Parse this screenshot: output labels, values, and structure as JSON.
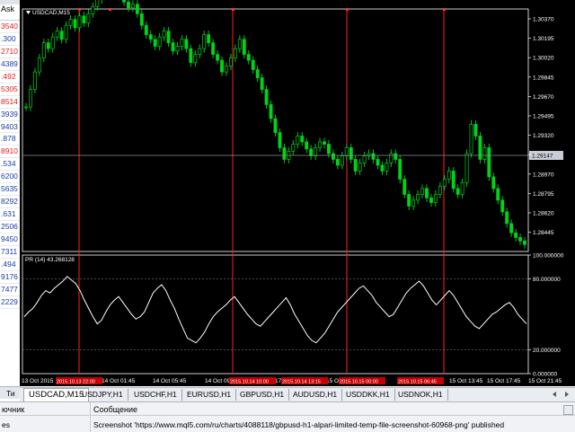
{
  "market_watch": {
    "header_label": "Ask",
    "rows": [
      {
        "value": "3540",
        "color": "red"
      },
      {
        "value": ".300",
        "color": "blue"
      },
      {
        "value": "2710",
        "color": "red"
      },
      {
        "value": "4389",
        "color": "blue"
      },
      {
        "value": ".492",
        "color": "red"
      },
      {
        "value": "5305",
        "color": "red"
      },
      {
        "value": "8514",
        "color": "red"
      },
      {
        "value": "3939",
        "color": "blue"
      },
      {
        "value": "9403",
        "color": "blue"
      },
      {
        "value": ".878",
        "color": "blue"
      },
      {
        "value": "8910",
        "color": "red"
      },
      {
        "value": ".534",
        "color": "blue"
      },
      {
        "value": "6200",
        "color": "blue"
      },
      {
        "value": "5635",
        "color": "blue"
      },
      {
        "value": "8292",
        "color": "blue"
      },
      {
        "value": ".631",
        "color": "blue"
      },
      {
        "value": "2506",
        "color": "blue"
      },
      {
        "value": "9450",
        "color": "blue"
      },
      {
        "value": "7311",
        "color": "blue"
      },
      {
        "value": ".494",
        "color": "blue"
      },
      {
        "value": "9176",
        "color": "blue"
      },
      {
        "value": "7477",
        "color": "blue"
      },
      {
        "value": "2229",
        "color": "blue"
      }
    ],
    "bottom_tab": "Ти"
  },
  "chart": {
    "symbol_label": "USDCAD,M15",
    "price_levels": [
      "1.30370",
      "1.30195",
      "1.30020",
      "1.29845",
      "1.29670",
      "1.29495",
      "1.29320",
      "1.29147",
      "1.28970",
      "1.28795",
      "1.28620",
      "1.28445"
    ],
    "current_price_label": "1.29147",
    "indicator_label": "PR (14) 43.268128",
    "indicator_levels": [
      "100.000000",
      "80.000000",
      "20.000000",
      "0.000000"
    ],
    "time_labels": [
      "13 Oct 2015",
      "14 Oct 01:45",
      "14 Oct 05:45",
      "14 Oct 09:45",
      "14 Oct 17",
      "15 Oct 01:45",
      "15 Oct 13:45",
      "15 Oct 17:45",
      "15 Oct 21:45"
    ],
    "marker_labels": [
      "2015.10.13 22:00",
      "2015.10.14 10:00",
      "2015.10.14 13:15",
      "2015.10.15 00:00",
      "2015.10.15 06:45"
    ],
    "colors": {
      "candle": "#00d21d",
      "separator": "#ff2020",
      "marker_bg": "#c40000",
      "grid": "#ffffff",
      "indicator": "#ffffff",
      "price_bg": "#000000"
    }
  },
  "chart_data": {
    "type": "line",
    "title": "USDCAD,M15",
    "series": [
      {
        "name": "USDCAD,M15",
        "values": [
          1.296,
          1.2975,
          1.299,
          1.3002,
          1.3015,
          1.301,
          1.302,
          1.3025,
          1.3018,
          1.303,
          1.3035,
          1.3028,
          1.3038,
          1.3032,
          1.304,
          1.3046,
          1.3052,
          1.306,
          1.307,
          1.3074,
          1.306,
          1.3055,
          1.305,
          1.3045,
          1.3048,
          1.304,
          1.303,
          1.3022,
          1.3018,
          1.3012,
          1.302,
          1.3025,
          1.3015,
          1.3008,
          1.3012,
          1.3018,
          1.301,
          1.2998,
          1.3005,
          1.301,
          1.3022,
          1.3015,
          1.3005,
          1.3,
          1.299,
          1.2995,
          1.3002,
          1.301,
          1.3018,
          1.3005,
          1.3,
          1.2992,
          1.2985,
          1.2975,
          1.2962,
          1.295,
          1.2938,
          1.2925,
          1.2915,
          1.2922,
          1.2928,
          1.2935,
          1.293,
          1.2924,
          1.2918,
          1.2925,
          1.293,
          1.2928,
          1.292,
          1.2915,
          1.291,
          1.2918,
          1.2925,
          1.2915,
          1.2905,
          1.2912,
          1.2918,
          1.292,
          1.2915,
          1.291,
          1.2905,
          1.2912,
          1.292,
          1.2915,
          1.2898,
          1.2885,
          1.2875,
          1.288,
          1.2885,
          1.289,
          1.2882,
          1.2878,
          1.2885,
          1.2892,
          1.2898,
          1.2905,
          1.289,
          1.2885,
          1.2895,
          1.292,
          1.2945,
          1.2935,
          1.2915,
          1.2925,
          1.29,
          1.289,
          1.288,
          1.287,
          1.286,
          1.2852,
          1.2848,
          1.2845,
          1.2842
        ]
      },
      {
        "name": "PR (14)",
        "values": [
          48,
          52,
          55,
          60,
          66,
          70,
          68,
          72,
          75,
          78,
          82,
          79,
          76,
          70,
          62,
          55,
          48,
          42,
          45,
          52,
          58,
          62,
          65,
          60,
          55,
          50,
          46,
          48,
          52,
          60,
          68,
          72,
          75,
          70,
          62,
          55,
          46,
          38,
          30,
          28,
          26,
          30,
          35,
          42,
          48,
          52,
          55,
          58,
          62,
          65,
          60,
          55,
          50,
          46,
          42,
          40,
          44,
          48,
          52,
          56,
          60,
          64,
          58,
          50,
          44,
          38,
          32,
          28,
          26,
          30,
          34,
          40,
          46,
          52,
          56,
          60,
          64,
          68,
          72,
          74,
          70,
          66,
          60,
          56,
          52,
          48,
          50,
          56,
          62,
          68,
          72,
          75,
          78,
          74,
          68,
          62,
          58,
          62,
          66,
          70,
          66,
          60,
          54,
          48,
          44,
          40,
          38,
          42,
          46,
          50,
          52,
          55,
          58,
          60,
          56,
          50,
          46,
          42
        ]
      }
    ],
    "ylim": [
      1.2836,
      1.3044
    ],
    "indicator_ylim": [
      0,
      100
    ],
    "grid": false,
    "legend": "top-left"
  },
  "tabs": [
    {
      "label": "USDCAD,M15",
      "active": true
    },
    {
      "label": "USDJPY,H1",
      "active": false
    },
    {
      "label": "USDCHF,H1",
      "active": false
    },
    {
      "label": "EURUSD,H1",
      "active": false
    },
    {
      "label": "GBPUSD,H1",
      "active": false
    },
    {
      "label": "AUDUSD,H1",
      "active": false
    },
    {
      "label": "USDDKK,H1",
      "active": false
    },
    {
      "label": "USDNOK,H1",
      "active": false
    }
  ],
  "journal": {
    "col_source": "ючник",
    "col_message": "Сообщение",
    "row_source": "es",
    "row_message": "Screenshot 'https://www.mql5.com/ru/charts/4088118/gbpusd-h1-alpari-limited-temp-file-screenshot-60968-png' published"
  }
}
